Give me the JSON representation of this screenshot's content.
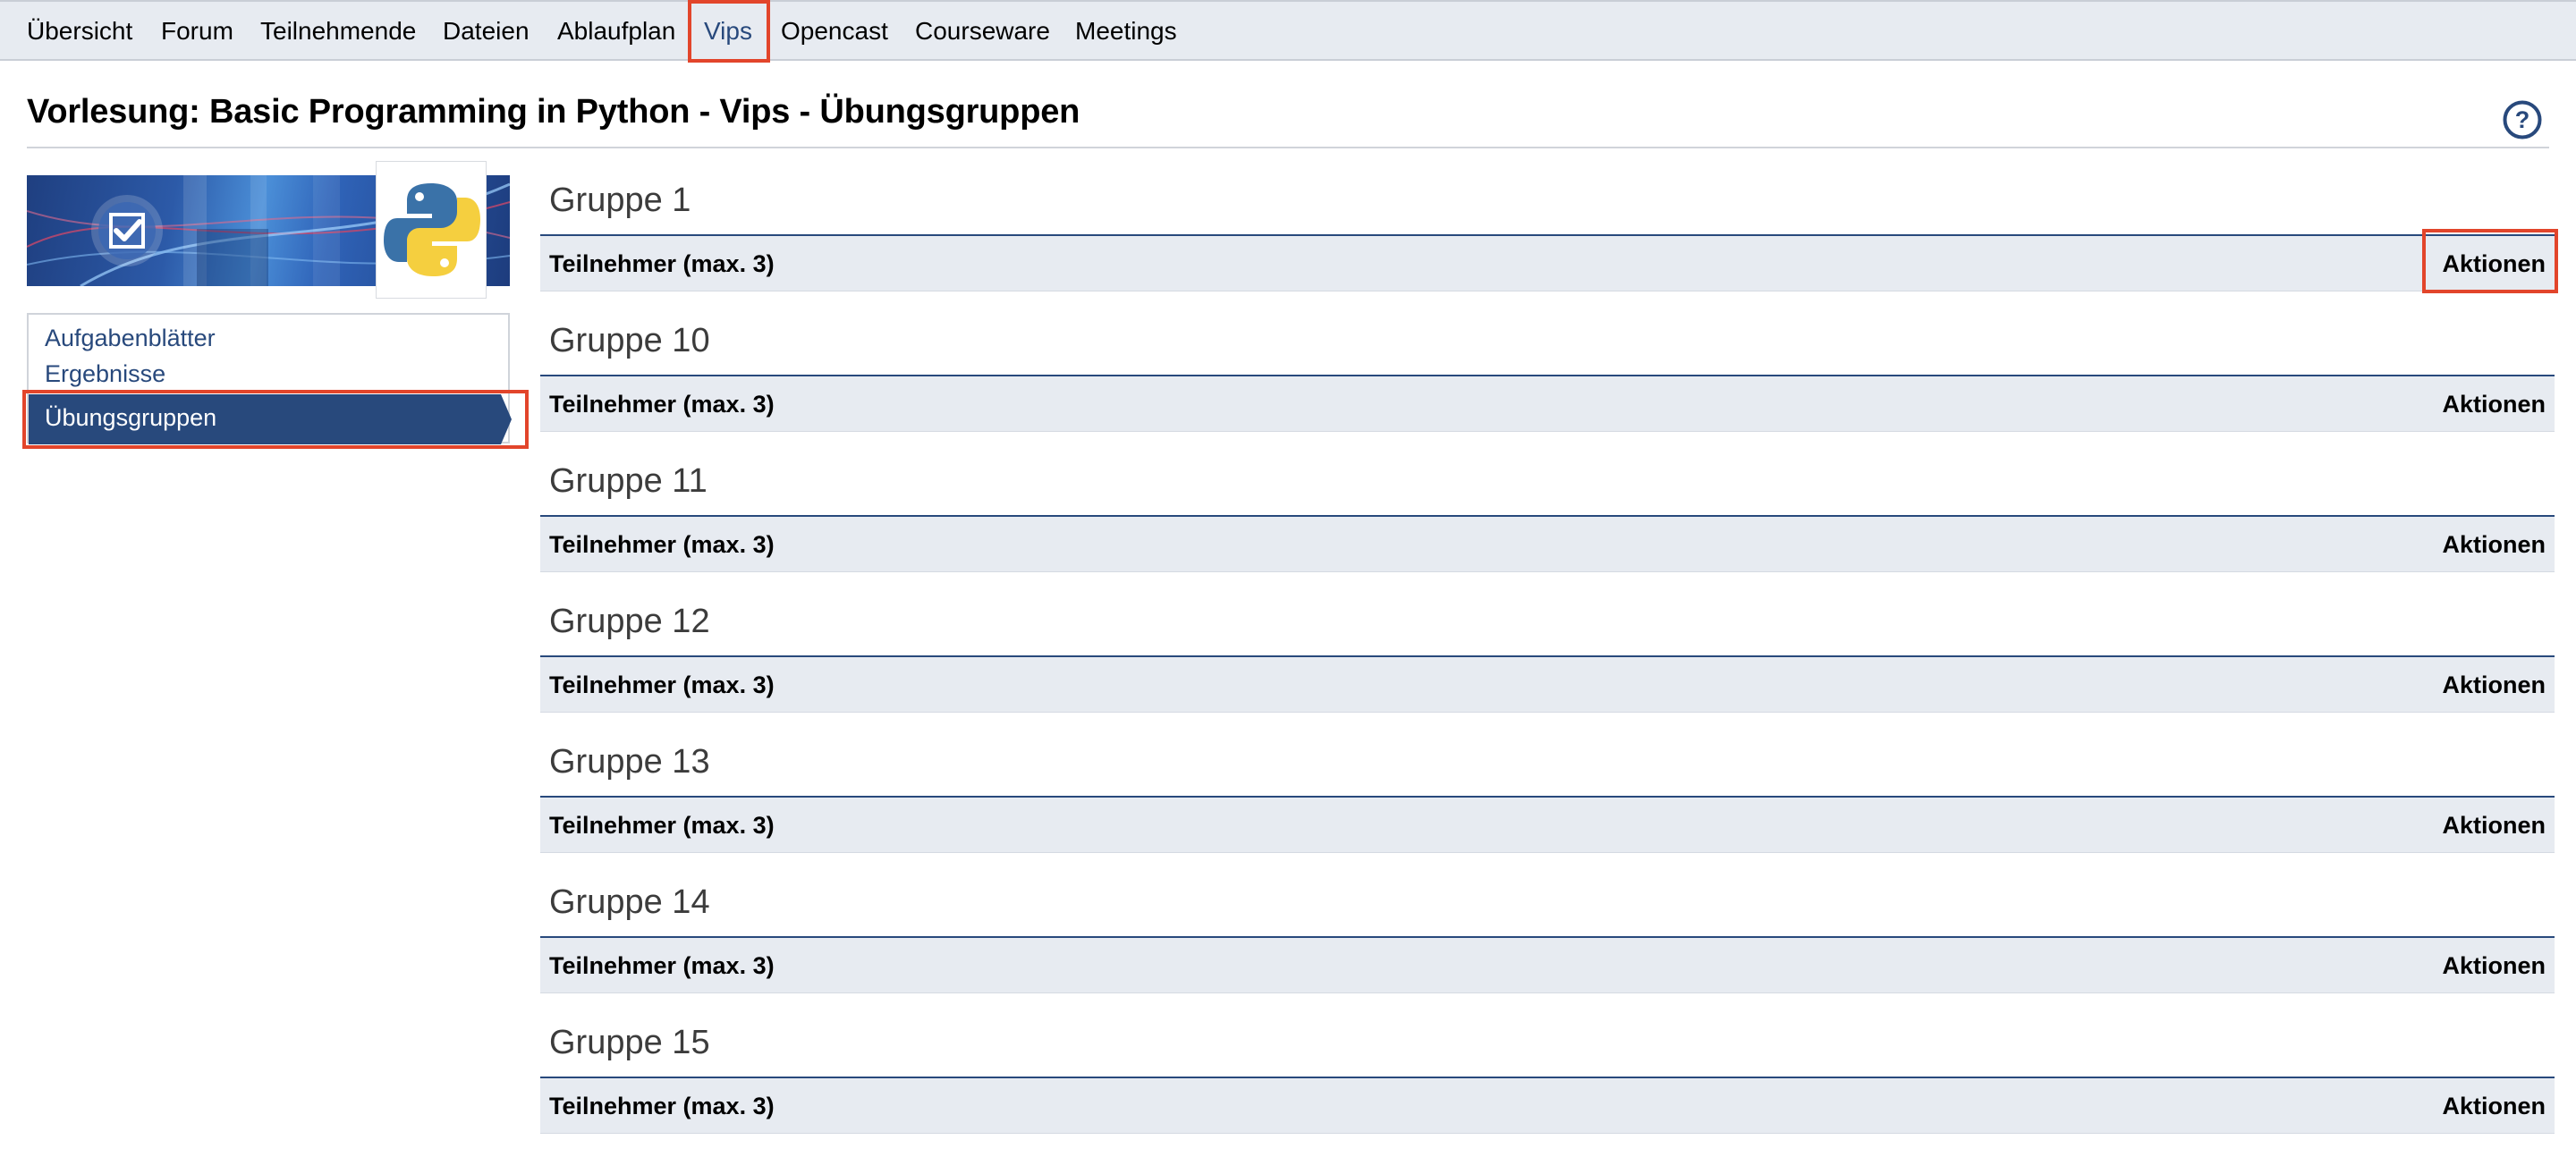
{
  "nav": {
    "tabs": [
      {
        "label": "Übersicht"
      },
      {
        "label": "Forum"
      },
      {
        "label": "Teilnehmende"
      },
      {
        "label": "Dateien"
      },
      {
        "label": "Ablaufplan"
      },
      {
        "label": "Vips"
      },
      {
        "label": "Opencast"
      },
      {
        "label": "Courseware"
      },
      {
        "label": "Meetings"
      }
    ],
    "active_tab": "Vips"
  },
  "page": {
    "title": "Vorlesung: Basic Programming in Python - Vips - Übungsgruppen",
    "help_icon": "question-circle-icon"
  },
  "sidebar": {
    "banner_icon": "checkbox-icon",
    "logo_icon": "python-logo-icon",
    "items": [
      {
        "label": "Aufgabenblätter"
      },
      {
        "label": "Ergebnisse"
      },
      {
        "label": "Übungsgruppen"
      }
    ],
    "active_item": "Übungsgruppen"
  },
  "groups": [
    {
      "name": "Gruppe 1",
      "participants_header": "Teilnehmer (max. 3)",
      "actions_header": "Aktionen"
    },
    {
      "name": "Gruppe 10",
      "participants_header": "Teilnehmer (max. 3)",
      "actions_header": "Aktionen"
    },
    {
      "name": "Gruppe 11",
      "participants_header": "Teilnehmer (max. 3)",
      "actions_header": "Aktionen"
    },
    {
      "name": "Gruppe 12",
      "participants_header": "Teilnehmer (max. 3)",
      "actions_header": "Aktionen"
    },
    {
      "name": "Gruppe 13",
      "participants_header": "Teilnehmer (max. 3)",
      "actions_header": "Aktionen"
    },
    {
      "name": "Gruppe 14",
      "participants_header": "Teilnehmer (max. 3)",
      "actions_header": "Aktionen"
    },
    {
      "name": "Gruppe 15",
      "participants_header": "Teilnehmer (max. 3)",
      "actions_header": "Aktionen"
    }
  ],
  "colors": {
    "accent": "#28497c",
    "nav_background": "#e7ebf1",
    "highlight": "#e2452b"
  }
}
